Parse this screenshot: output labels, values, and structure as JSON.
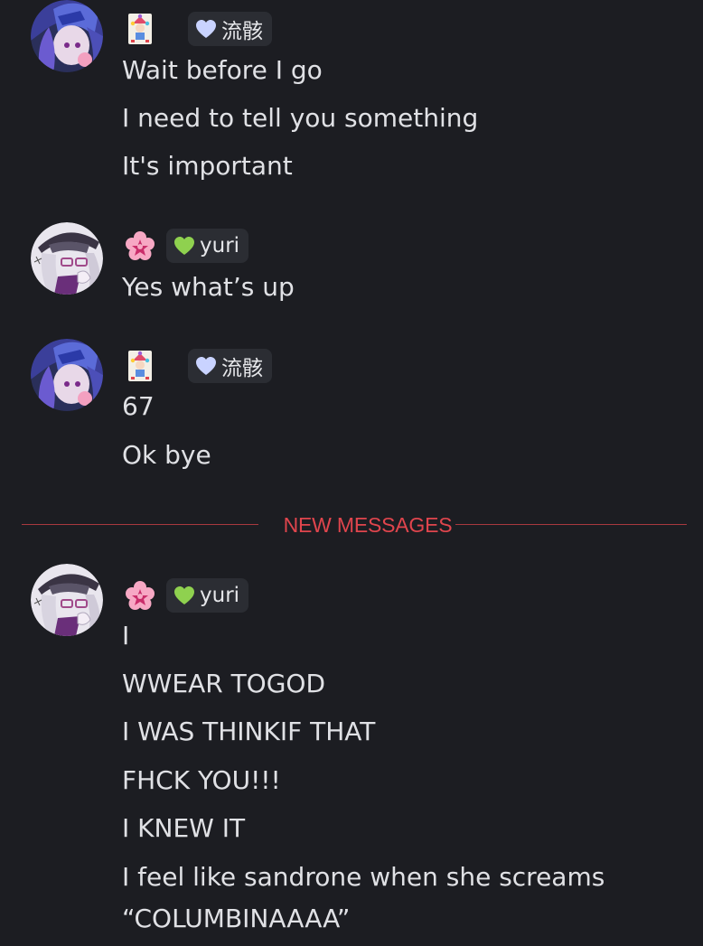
{
  "messages": [
    {
      "username": "流骸",
      "role_icon": "jester-card-icon",
      "lines": [
        "Wait before I go",
        "I need to tell you something",
        "It's important"
      ]
    },
    {
      "username": "yuri",
      "role_icon": "pink-flower-icon",
      "lines": [
        "Yes what’s up"
      ]
    },
    {
      "username": "流骸",
      "role_icon": "jester-card-icon",
      "lines": [
        "67",
        "Ok bye"
      ]
    },
    {
      "username": "yuri",
      "role_icon": "pink-flower-icon",
      "lines": [
        "I",
        "WWEAR TOGOD",
        "I WAS THINKIF THAT",
        "FHCK YOU!!!",
        "I KNEW IT",
        "I feel like sandrone when she screams",
        "“COLUMBINAAAA”"
      ]
    }
  ],
  "divider": {
    "label": "NEW MESSAGES"
  },
  "colors": {
    "background": "#1c1d22",
    "divider": "#e0454d",
    "tag_bg": "#2b2d33",
    "heart_blue": "#c9d3ff",
    "heart_green": "#8fd14f"
  }
}
